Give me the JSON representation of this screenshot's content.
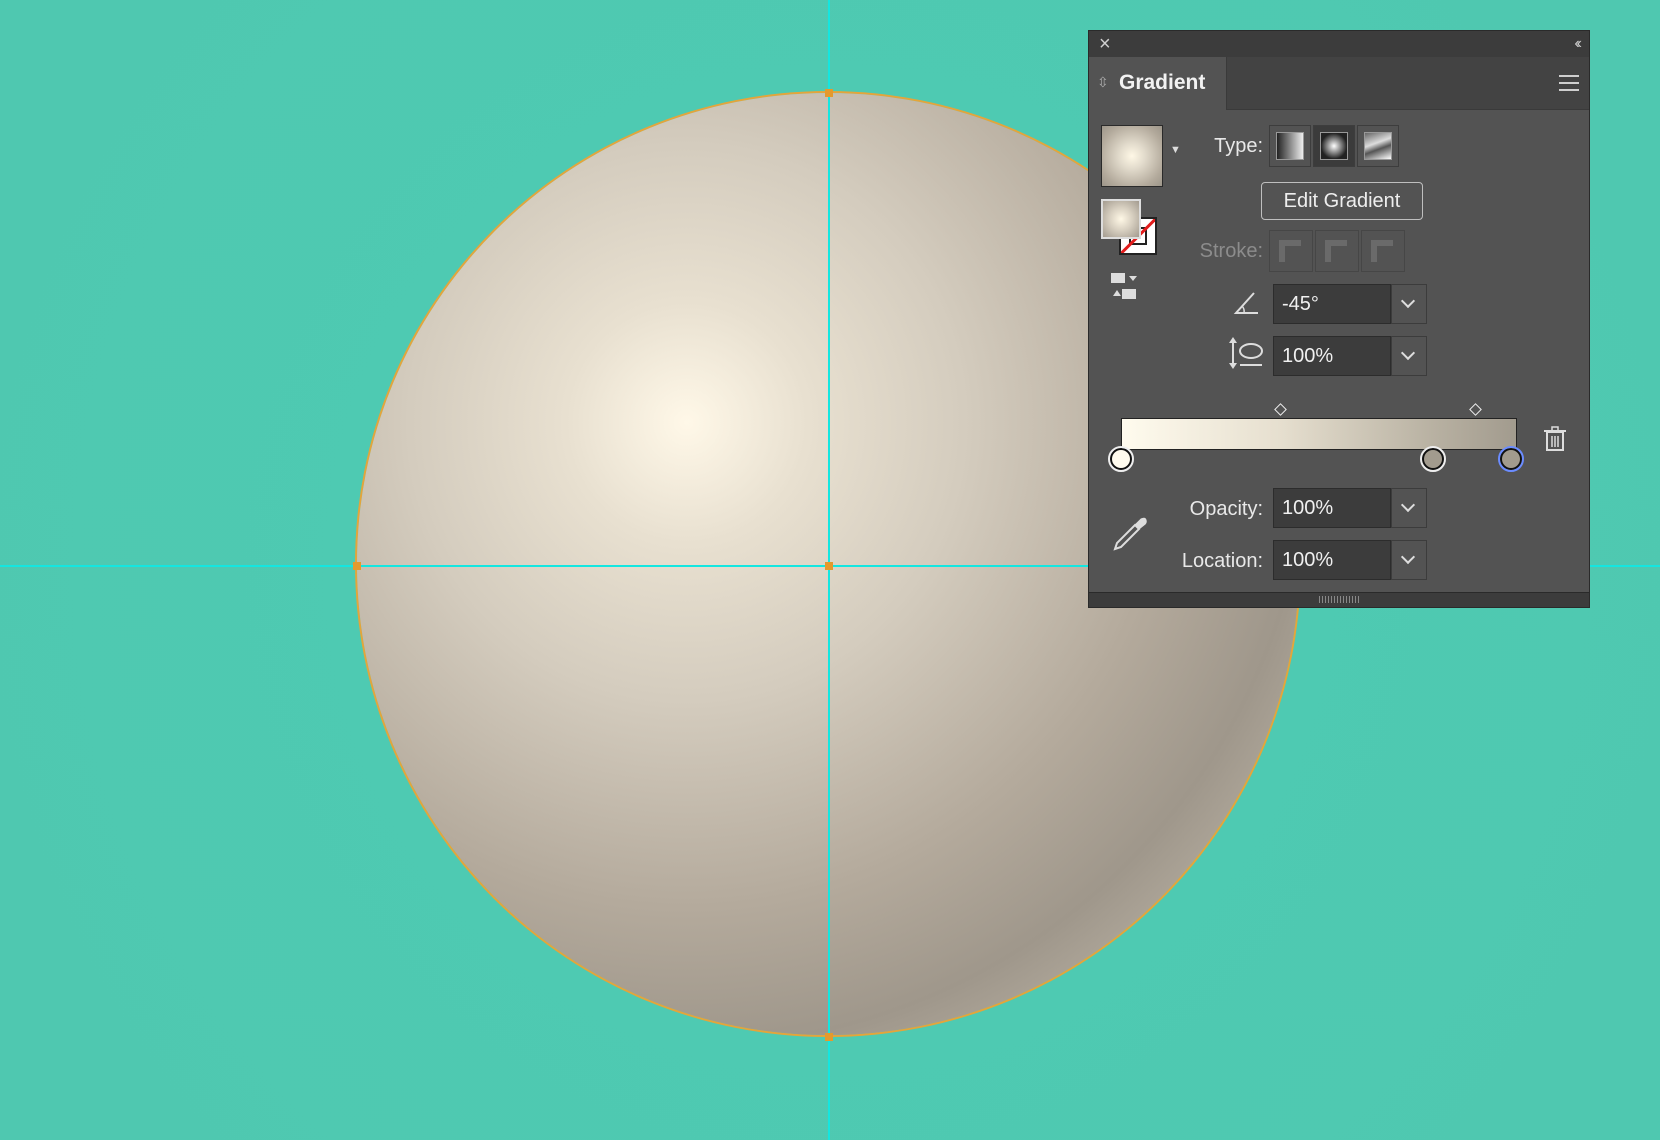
{
  "app": {
    "panel_title": "Gradient"
  },
  "gradient_panel": {
    "type_label": "Type:",
    "type_buttons": [
      {
        "name": "linear",
        "selected": false
      },
      {
        "name": "radial",
        "selected": true
      },
      {
        "name": "freeform",
        "selected": false
      }
    ],
    "edit_gradient_label": "Edit Gradient",
    "stroke_label": "Stroke:",
    "angle_value": "-45°",
    "aspect_ratio_value": "100%",
    "opacity_label": "Opacity:",
    "opacity_value": "100%",
    "location_label": "Location:",
    "location_value": "100%",
    "gradient_stops": [
      {
        "color": "#fffbee",
        "location_percent": 0,
        "selected": false
      },
      {
        "color": "#a29b8e",
        "location_percent": 79,
        "selected": false
      },
      {
        "color": "#a29b8e",
        "location_percent": 100,
        "selected": true
      }
    ],
    "midpoints_percent": [
      40,
      89
    ]
  },
  "colors": {
    "canvas": "#4ec9b0",
    "guide": "#14e6e0",
    "selection": "#e4a53b",
    "panel_bg": "#535353"
  }
}
